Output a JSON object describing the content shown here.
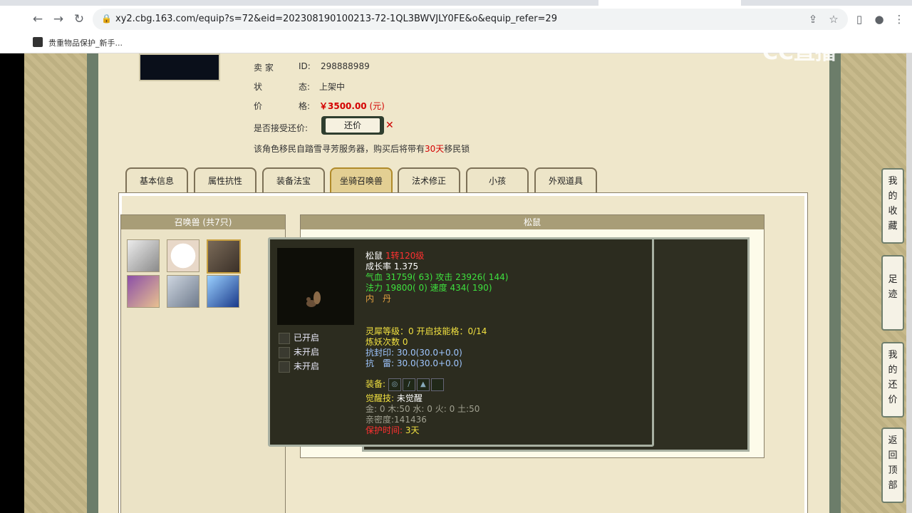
{
  "browser": {
    "url": "xy2.cbg.163.com/equip?s=72&eid=202308190100213-72-1QL3BWVJLY0FE&o&equip_refer=29",
    "bookmark_label": "贵重物品保护_新手..."
  },
  "seller": {
    "seller_label": "卖 家",
    "id_label": "ID:",
    "id_value": "298888989",
    "status_label_a": "状",
    "status_label_b": "态:",
    "status_value": "上架中",
    "price_label_a": "价",
    "price_label_b": "格:",
    "price_value": "￥3500.00",
    "price_unit": "(元)",
    "haggle_label": "是否接受还价:",
    "haggle_button": "还价",
    "migrate_note_prefix": "该角色移民自踏雪寻芳服务器，购买后将带有",
    "migrate_days": "30天",
    "migrate_note_suffix": "移民锁"
  },
  "tabs": [
    "基本信息",
    "属性抗性",
    "装备法宝",
    "坐骑召唤兽",
    "法术修正",
    "小孩",
    "外观道具"
  ],
  "active_tab": 3,
  "pets_panel": {
    "header": "召唤兽 (共7只)"
  },
  "detail_panel": {
    "header": "松鼠"
  },
  "tooltip": {
    "name": "松鼠",
    "level": "1转120级",
    "growth": "成长率 1.375",
    "hp_label": "气血",
    "hp_value": "31759( 63)",
    "atk_label": "攻击",
    "atk_value": "23926( 144)",
    "mp_label": "法力",
    "mp_value": "19800( 0)",
    "spd_label": "速度",
    "spd_value": "434( 190)",
    "neidan": "内　丹",
    "seal_open": "已开启",
    "seal_closed_1": "未开启",
    "seal_closed_2": "未开启",
    "spirit_line": "灵犀等级：0 开启技能格：0/14",
    "refine_line": "炼妖次数 0",
    "resist_seal": "抗封印: 30.0(30.0+0.0)",
    "resist_thunder": "抗　雷: 30.0(30.0+0.0)",
    "equip_label": "装备:",
    "awaken_label": "觉醒技:",
    "awaken_value": "未觉醒",
    "elements": "金: 0 木:50 水: 0 火: 0 土:50",
    "intimacy": "亲密度:141436",
    "protect_label": "保护时间:",
    "protect_value": "3天"
  },
  "side_menu": [
    {
      "label": "我的收藏"
    },
    {
      "label": "足迹"
    },
    {
      "label": "我的还价"
    },
    {
      "label": "返回顶部"
    }
  ],
  "watermark": "CC直播",
  "colors": {
    "price_red": "#d40000",
    "tooltip_bg": "#2c2c1f",
    "attr_green": "#3ee03e",
    "attr_yellow": "#f0e040",
    "page_border": "#6c7d6a"
  }
}
